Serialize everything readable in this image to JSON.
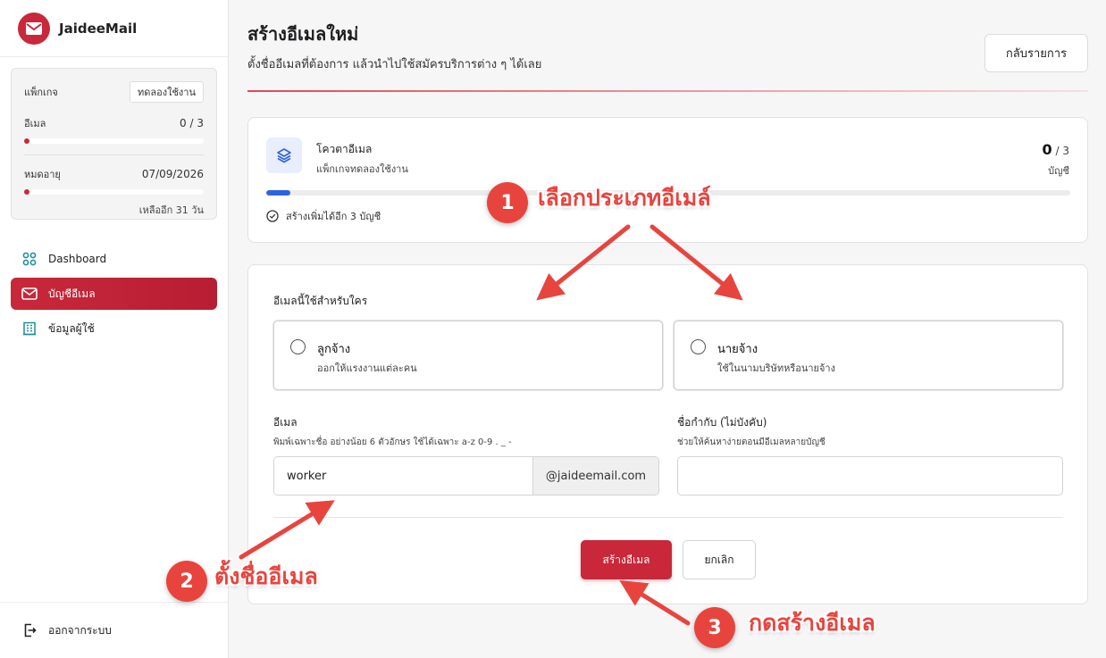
{
  "brand": {
    "name": "JaideeMail",
    "accent": "#c8283a"
  },
  "package": {
    "label": "แพ็กเกจ",
    "badge": "ทดลองใช้งาน",
    "email_label": "อีเมล",
    "email_usage": "0 / 3",
    "email_usage_fraction": 0,
    "expiry_label": "หมดอายุ",
    "expiry_date": "07/09/2026",
    "remaining": "เหลืออีก 31 วัน"
  },
  "nav": {
    "items": [
      {
        "label": "Dashboard",
        "icon": "grid-icon",
        "active": false
      },
      {
        "label": "บัญชีอีเมล",
        "icon": "mail-icon",
        "active": true
      },
      {
        "label": "ข้อมูลผู้ใช้",
        "icon": "building-icon",
        "active": false
      }
    ],
    "logout": "ออกจากระบบ"
  },
  "header": {
    "title": "สร้างอีเมลใหม่",
    "subtitle": "ตั้งชื่ออีเมลที่ต้องการ แล้วนำไปใช้สมัครบริการต่าง ๆ ได้เลย",
    "back_label": "กลับรายการ"
  },
  "quota": {
    "title": "โควตาอีเมล",
    "subtitle": "แพ็กเกจทดลองใช้งาน",
    "used": "0",
    "total": "/ 3",
    "unit": "บัญชี",
    "fill_fraction": 0.03,
    "more": "สร้างเพิ่มได้อีก 3 บัญชี",
    "bar_color": "#2f62e3"
  },
  "form": {
    "question": "อีเมลนี้ใช้สำหรับใคร",
    "options": [
      {
        "title": "ลูกจ้าง",
        "desc": "ออกให้แรงงานแต่ละคน"
      },
      {
        "title": "นายจ้าง",
        "desc": "ใช้ในนามบริษัทหรือนายจ้าง"
      }
    ],
    "email_label": "อีเมล",
    "email_help": "พิมพ์เฉพาะชื่อ อย่างน้อย 6 ตัวอักษร ใช้ได้เฉพาะ a-z 0-9 . _ -",
    "email_value": "worker",
    "email_suffix": "@jaideemail.com",
    "alias_label": "ชื่อกำกับ (ไม่บังคับ)",
    "alias_help": "ช่วยให้ค้นหาง่ายตอนมีอีเมลหลายบัญชี",
    "alias_value": "",
    "create_label": "สร้างอีเมล",
    "cancel_label": "ยกเลิก"
  },
  "annotations": [
    {
      "number": "1",
      "text": "เลือกประเภทอีเมล์"
    },
    {
      "number": "2",
      "text": "ตั้งชื่ออีเมล"
    },
    {
      "number": "3",
      "text": "กดสร้างอีเมล"
    }
  ],
  "annotation_color": "#e8443e"
}
